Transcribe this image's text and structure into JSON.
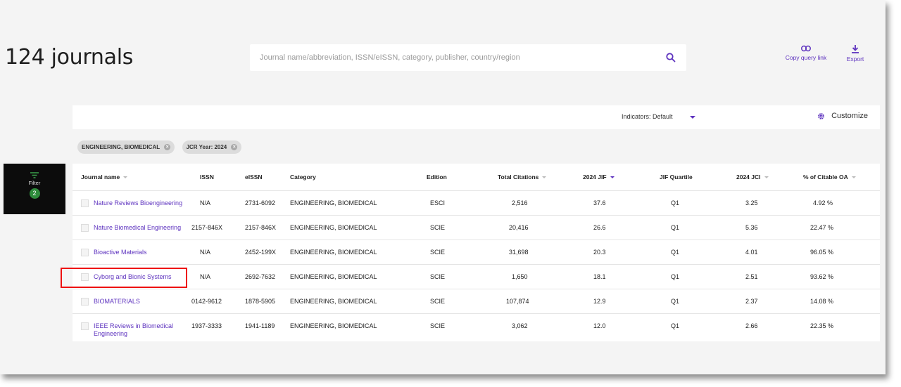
{
  "header": {
    "title": "124 journals",
    "search_placeholder": "Journal name/abbreviation, ISSN/eISSN, category, publisher, country/region",
    "copy_query_label": "Copy query link",
    "export_label": "Export"
  },
  "toolbar": {
    "indicators_label": "Indicators: Default",
    "customize_label": "Customize"
  },
  "filters": {
    "chips": [
      "ENGINEERING, BIOMEDICAL",
      "JCR Year: 2024"
    ],
    "panel_label": "Filter",
    "panel_count": "2"
  },
  "table": {
    "columns": [
      "Journal name",
      "ISSN",
      "eISSN",
      "Category",
      "Edition",
      "Total Citations",
      "2024 JIF",
      "JIF Quartile",
      "2024 JCI",
      "% of Citable OA"
    ],
    "rows": [
      {
        "name": "Nature Reviews Bioengineering",
        "issn": "N/A",
        "eissn": "2731-6092",
        "category": "ENGINEERING, BIOMEDICAL",
        "edition": "ESCI",
        "citations": "2,516",
        "jif": "37.6",
        "quartile": "Q1",
        "jci": "3.25",
        "oa": "4.92 %"
      },
      {
        "name": "Nature Biomedical Engineering",
        "issn": "2157-846X",
        "eissn": "2157-846X",
        "category": "ENGINEERING, BIOMEDICAL",
        "edition": "SCIE",
        "citations": "20,416",
        "jif": "26.6",
        "quartile": "Q1",
        "jci": "5.36",
        "oa": "22.47 %"
      },
      {
        "name": "Bioactive Materials",
        "issn": "N/A",
        "eissn": "2452-199X",
        "category": "ENGINEERING, BIOMEDICAL",
        "edition": "SCIE",
        "citations": "31,698",
        "jif": "20.3",
        "quartile": "Q1",
        "jci": "4.01",
        "oa": "96.05 %"
      },
      {
        "name": "Cyborg and Bionic Systems",
        "issn": "N/A",
        "eissn": "2692-7632",
        "category": "ENGINEERING, BIOMEDICAL",
        "edition": "SCIE",
        "citations": "1,650",
        "jif": "18.1",
        "quartile": "Q1",
        "jci": "2.51",
        "oa": "93.62 %"
      },
      {
        "name": "BIOMATERIALS",
        "issn": "0142-9612",
        "eissn": "1878-5905",
        "category": "ENGINEERING, BIOMEDICAL",
        "edition": "SCIE",
        "citations": "107,874",
        "jif": "12.9",
        "quartile": "Q1",
        "jci": "2.37",
        "oa": "14.08 %"
      },
      {
        "name": "IEEE Reviews in Biomedical Engineering",
        "issn": "1937-3333",
        "eissn": "1941-1189",
        "category": "ENGINEERING, BIOMEDICAL",
        "edition": "SCIE",
        "citations": "3,062",
        "jif": "12.0",
        "quartile": "Q1",
        "jci": "2.66",
        "oa": "22.35 %"
      }
    ]
  },
  "colors": {
    "accent": "#5e33bf",
    "filter_badge": "#2f8c3c",
    "highlight_box": "#ee1111"
  },
  "icons": [
    "search-icon",
    "link-icon",
    "download-icon",
    "gear-icon",
    "filter-icon",
    "close-icon",
    "chevron-down-icon",
    "sort-icon"
  ]
}
